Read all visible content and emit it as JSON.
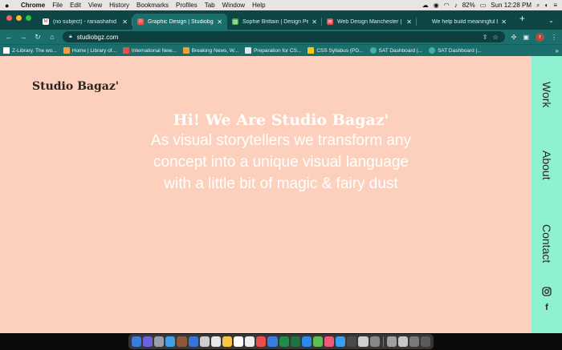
{
  "menubar": {
    "app": "Chrome",
    "items": [
      "File",
      "Edit",
      "View",
      "History",
      "Bookmarks",
      "Profiles",
      "Tab",
      "Window",
      "Help"
    ],
    "battery": "82%",
    "clock": "Sun 12:28 PM"
  },
  "tabs": [
    {
      "title": "(no subject) - raniashahid",
      "icon_color": "#ffffff",
      "icon_glyph": "M"
    },
    {
      "title": "Graphic Design | Studiobgz",
      "icon_color": "#e85a4f",
      "icon_glyph": "☺"
    },
    {
      "title": "Sophie Brittain | Design Pe",
      "icon_color": "#4caf50",
      "icon_glyph": "▥"
    },
    {
      "title": "Web Design Manchester |",
      "icon_color": "#e84f4f",
      "icon_glyph": "✉"
    },
    {
      "title": "We help build meaningful b",
      "icon_color": "#0d4645",
      "icon_glyph": ""
    }
  ],
  "address": {
    "url": "studiobgz.com",
    "avatar_letter": "r"
  },
  "bookmarks": [
    {
      "label": "Z-Library. The wo...",
      "color": "#ffffff"
    },
    {
      "label": "Home | Library of...",
      "color": "#f0a040"
    },
    {
      "label": "International New...",
      "color": "#e84f4f"
    },
    {
      "label": "Breaking News, W...",
      "color": "#f0a030"
    },
    {
      "label": "Preparation for CS...",
      "color": "#dfe8e8"
    },
    {
      "label": "CSS Syllabus (PD...",
      "color": "#f5c518"
    },
    {
      "label": "SAT Dashboard |...",
      "color": "#3bb4a0"
    },
    {
      "label": "SAT Dashboard |...",
      "color": "#3bb4a0"
    }
  ],
  "page": {
    "logo": "Studio Bagaz'",
    "hero_title": "Hi! We Are Studio Bagaz'",
    "hero_lines": [
      "As visual storytellers we transform any",
      "concept into a unique visual language",
      "with a little bit of magic & fairy dust"
    ],
    "nav": [
      "Work",
      "About",
      "Contact"
    ],
    "social_icons": [
      "instagram-icon",
      "facebook-icon"
    ]
  },
  "colors": {
    "page_bg": "#fcd0bd",
    "sidenav_bg": "#8ef2d2",
    "chrome_frame": "#0d4645",
    "chrome_toolbar": "#1a6e6b"
  },
  "dock_apps": [
    "#3b7bdc",
    "#6a63e0",
    "#9aa0a6",
    "#3fa0e8",
    "#8b5a3c",
    "#3575d8",
    "#cfcfcf",
    "#e7e7e7",
    "#f6c544",
    "#ffffff",
    "#eeeeee",
    "#e84f4f",
    "#3a7de0",
    "#1f8b4c",
    "#207245",
    "#2a8be8",
    "#5bbf55",
    "#f05a7a",
    "#3a9ef0",
    "#4a4a4a",
    "#cfcfcf",
    "#888888",
    "#a0a0a0",
    "#c7c7c7",
    "#7a7a7a",
    "#5b5b5b"
  ]
}
